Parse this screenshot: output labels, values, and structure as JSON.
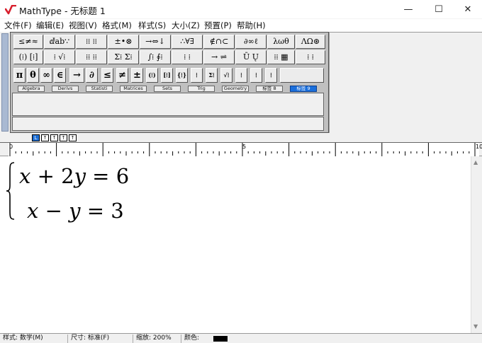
{
  "window": {
    "title": "MathType - 无标题 1",
    "controls": {
      "minimize": "—",
      "maximize": "☐",
      "close": "✕"
    }
  },
  "menu": [
    "文件(F)",
    "编辑(E)",
    "视图(V)",
    "格式(M)",
    "样式(S)",
    "大小(Z)",
    "预置(P)",
    "帮助(H)"
  ],
  "palette": {
    "row1": [
      "≤≠≈",
      "ⅆab∵",
      "⁞⁞ ⁞⁞",
      "±•⊗",
      "→⇔↓",
      "∴∀∃",
      "∉∩⊂",
      "∂∞ℓ",
      "λωθ",
      "ΛΩ⊛"
    ],
    "row2": [
      "(⁞) [⁞]",
      "⁞ √⁞",
      "⁞⁞ ⁞⁞",
      "Σ⁞ Σ⁞",
      "∫⁞ ∮⁞",
      "⁞ ⁞",
      "→ ⇌",
      "Ū Ų",
      "⁞⁞ ▦",
      "⁞ ⁞"
    ],
    "symbols": [
      "π",
      "θ",
      "∞",
      "∈",
      "→",
      "∂",
      "≤",
      "≠",
      "±",
      "(⁞)",
      "[⁞]",
      "{⁞}",
      "⁞",
      "Σ⁞",
      "√⁞",
      "⁞",
      "⁞",
      "⁞"
    ],
    "tabs": [
      "Algebra",
      "Derivs",
      "Statisti",
      "Matrices",
      "Sets",
      "Trig",
      "Geometry",
      "标签 8",
      "标签 9"
    ],
    "active_tab": "标签 9"
  },
  "size_buttons": [
    "L",
    "↑",
    "↑",
    "↑",
    "↑"
  ],
  "ruler": {
    "marks": [
      "0",
      "5",
      "10"
    ]
  },
  "equation": {
    "line1": {
      "a": "x",
      "op1": "+",
      "b": "2",
      "c": "y",
      "eq": "=",
      "rhs": "6"
    },
    "line2": {
      "a": "x",
      "op1": "−",
      "c": "y",
      "eq": "=",
      "rhs": "3"
    }
  },
  "status": {
    "style": "样式: 数学(M)",
    "size": "尺寸: 标准(F)",
    "zoom": "缩放: 200%",
    "color": "颜色:"
  },
  "colors": {
    "accent": "#1b6fdb",
    "logo": "#d81e2c"
  }
}
